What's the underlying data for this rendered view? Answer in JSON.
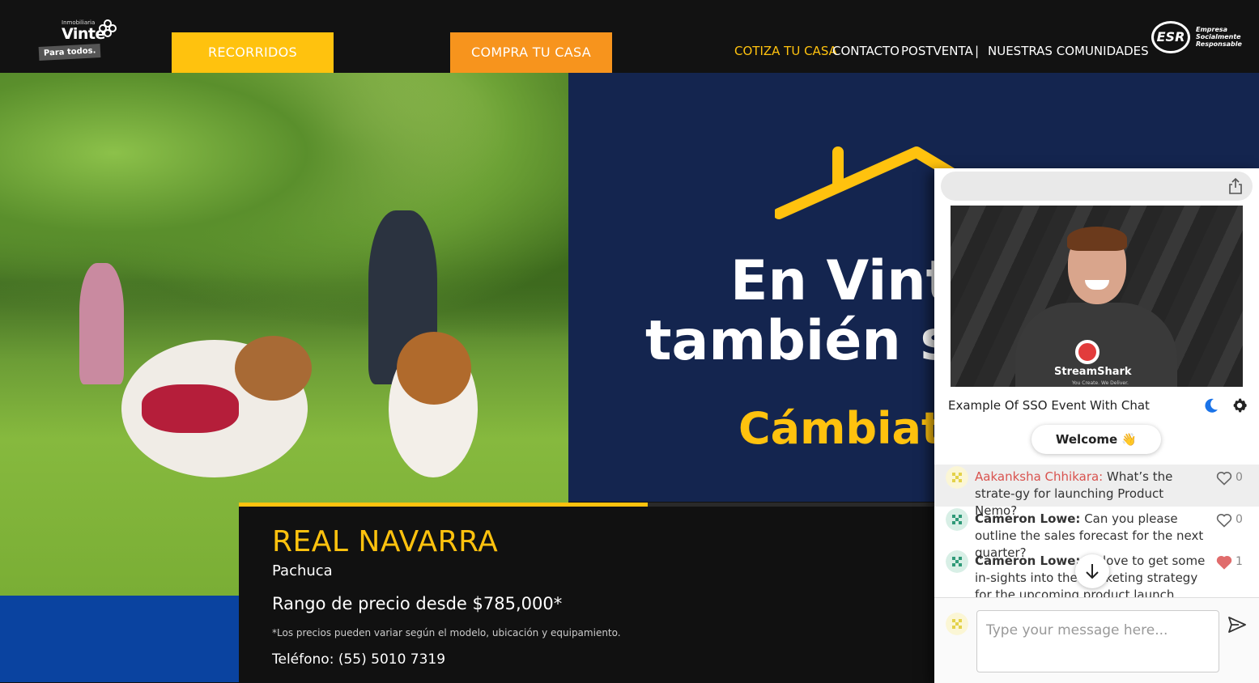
{
  "header": {
    "logo": {
      "small": "Inmobiliaria",
      "brand": "Vinte",
      "tag": "Para todos."
    },
    "buttons": {
      "tour": "RECORRIDOS VIRTUALES",
      "buy": "COMPRA TU CASA ONLINE"
    },
    "nav": [
      "COTIZA TU CASA",
      "CONTACTO",
      "POSTVENTA",
      "|",
      "NUESTRAS COMUNIDADES"
    ],
    "esr": {
      "mark": "ESR",
      "line1": "Empresa",
      "line2": "Socialmente",
      "line3": "Responsable"
    }
  },
  "banner": {
    "line1": "En Vint",
    "line2": "también sc",
    "line3": "Cámbiate"
  },
  "listing": {
    "title": "REAL NAVARRA",
    "city": "Pachuca",
    "price": "Rango de precio desde $785,000*",
    "note": "*Los precios pueden variar según el modelo, ubicación y equipamiento.",
    "phone": "Teléfono: (55) 5010 7319"
  },
  "widget": {
    "video": {
      "brand": "StreamShark",
      "tagline": "You Create. We Deliver."
    },
    "event_title": "Example Of SSO Event With Chat",
    "welcome": "Welcome 👋",
    "messages": [
      {
        "name": "Aakanksha Chhikara:",
        "text": " What’s the strate-gy for launching Product Nemo?",
        "likes": "0",
        "liked": false
      },
      {
        "name": "Cameron Lowe:",
        "text": " Can you please outline the sales forecast for the next quarter?",
        "likes": "0",
        "liked": false
      },
      {
        "name": "Cameron Lowe:",
        "text": " I'd love to get some in-sights into the marketing strategy for the upcoming product launch",
        "likes": "1",
        "liked": true
      }
    ],
    "input_placeholder": "Type your message here...",
    "colors": {
      "accent": "#ffc20e",
      "orange": "#f7941d",
      "heart": "#e06c6c",
      "moon": "#1a73e8"
    }
  }
}
